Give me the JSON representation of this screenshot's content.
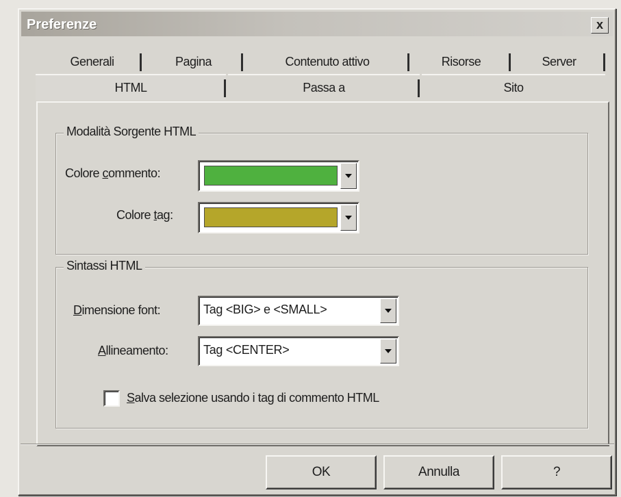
{
  "window": {
    "title": "Preferenze",
    "close_label": "x"
  },
  "tabs_row1": [
    {
      "label": "Generali"
    },
    {
      "label": "Pagina"
    },
    {
      "label": "Contenuto attivo"
    },
    {
      "label": "Risorse"
    },
    {
      "label": "Server"
    }
  ],
  "tabs_row2": [
    {
      "label": "HTML",
      "active": true
    },
    {
      "label": "Passa a",
      "active": false
    },
    {
      "label": "Sito",
      "active": false
    }
  ],
  "source_group": {
    "title": "Modalità Sorgente HTML",
    "comment_color": {
      "label": "Colore commento:",
      "value_color": "#4fb13f"
    },
    "tag_color": {
      "label": "Colore tag:",
      "value_color": "#b5a62a"
    }
  },
  "syntax_group": {
    "title": "Sintassi HTML",
    "font_size": {
      "label": "Dimensione font:",
      "value": "Tag <BIG> e <SMALL>"
    },
    "alignment": {
      "label": "Allineamento:",
      "value": "Tag <CENTER>"
    },
    "save_selection": {
      "label": "Salva selezione usando i tag di commento HTML",
      "checked": false
    }
  },
  "buttons": {
    "ok": "OK",
    "cancel": "Annulla",
    "help": "?"
  },
  "icons": {
    "close": "close-icon",
    "dropdown": "chevron-down-icon"
  }
}
